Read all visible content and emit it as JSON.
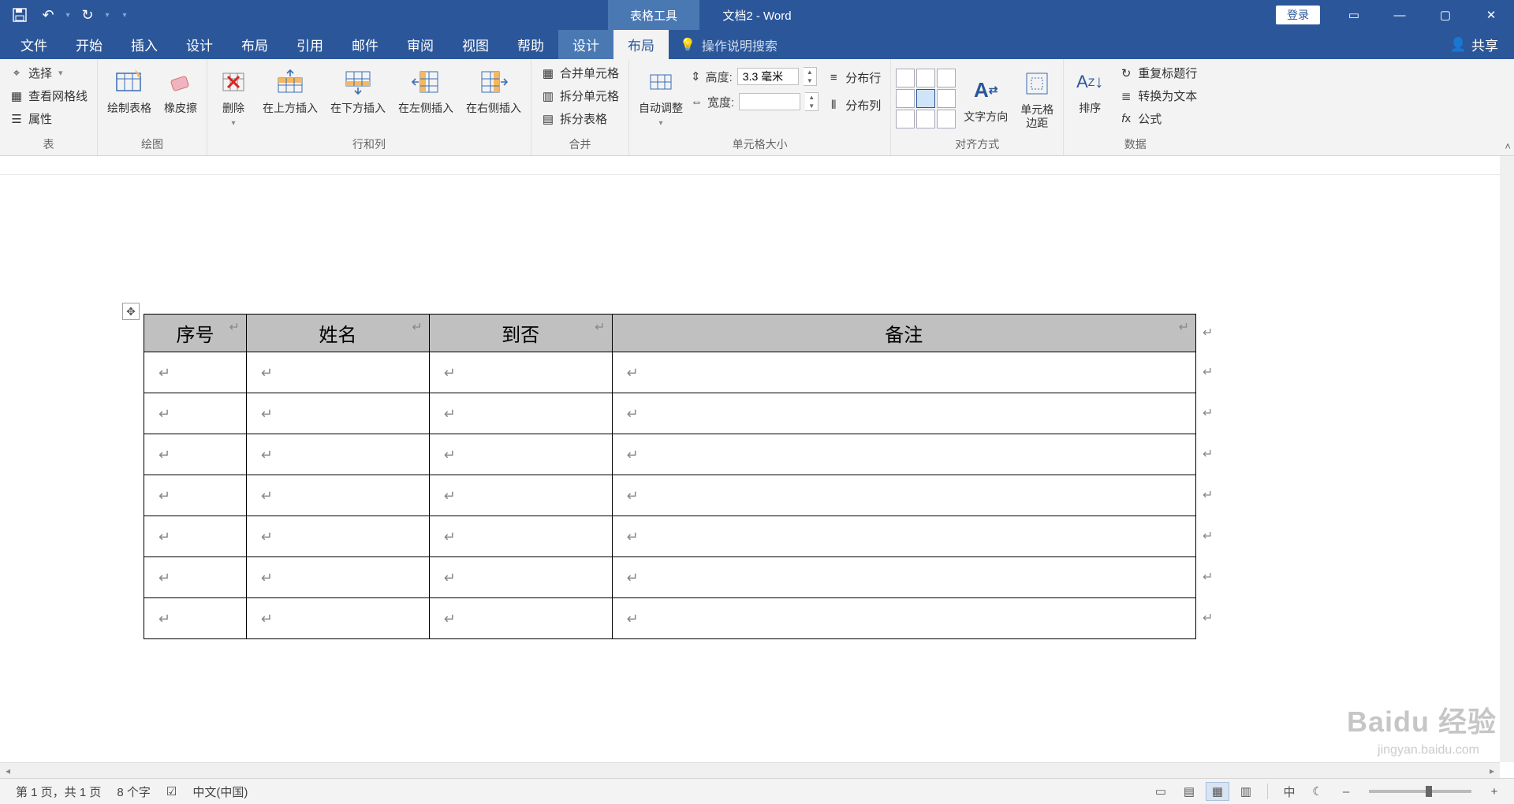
{
  "titlebar": {
    "doc_title": "文档2 - Word",
    "context_title": "表格工具",
    "login": "登录"
  },
  "tabs": {
    "file": "文件",
    "home": "开始",
    "insert": "插入",
    "design": "设计",
    "layout": "布局",
    "references": "引用",
    "mailings": "邮件",
    "review": "审阅",
    "view": "视图",
    "help": "帮助",
    "t_design": "设计",
    "t_layout": "布局",
    "tell_me": "操作说明搜索",
    "share": "共享"
  },
  "ribbon": {
    "grp_table": "表",
    "select": "选择",
    "gridlines": "查看网格线",
    "properties": "属性",
    "grp_draw": "绘图",
    "draw_table": "绘制表格",
    "eraser": "橡皮擦",
    "grp_rowscols": "行和列",
    "delete": "删除",
    "ins_above": "在上方插入",
    "ins_below": "在下方插入",
    "ins_left": "在左侧插入",
    "ins_right": "在右侧插入",
    "grp_merge": "合并",
    "merge_cells": "合并单元格",
    "split_cells": "拆分单元格",
    "split_table": "拆分表格",
    "grp_cellsize": "单元格大小",
    "autofit": "自动调整",
    "height_lbl": "高度:",
    "height_val": "3.3 毫米",
    "width_lbl": "宽度:",
    "width_val": "",
    "dist_rows": "分布行",
    "dist_cols": "分布列",
    "grp_align": "对齐方式",
    "text_dir": "文字方向",
    "cell_margins": "单元格\n边距",
    "grp_data": "数据",
    "sort": "排序",
    "repeat_header": "重复标题行",
    "to_text": "转换为文本",
    "formula": "公式"
  },
  "table": {
    "headers": [
      "序号",
      "姓名",
      "到否",
      "备注"
    ],
    "empty_rows": 7
  },
  "statusbar": {
    "page": "第 1 页，共 1 页",
    "words": "8 个字",
    "lang": "中文(中国)",
    "ime": "中"
  },
  "watermark": "Baidu 经验",
  "watermark_sub": "jingyan.baidu.com"
}
